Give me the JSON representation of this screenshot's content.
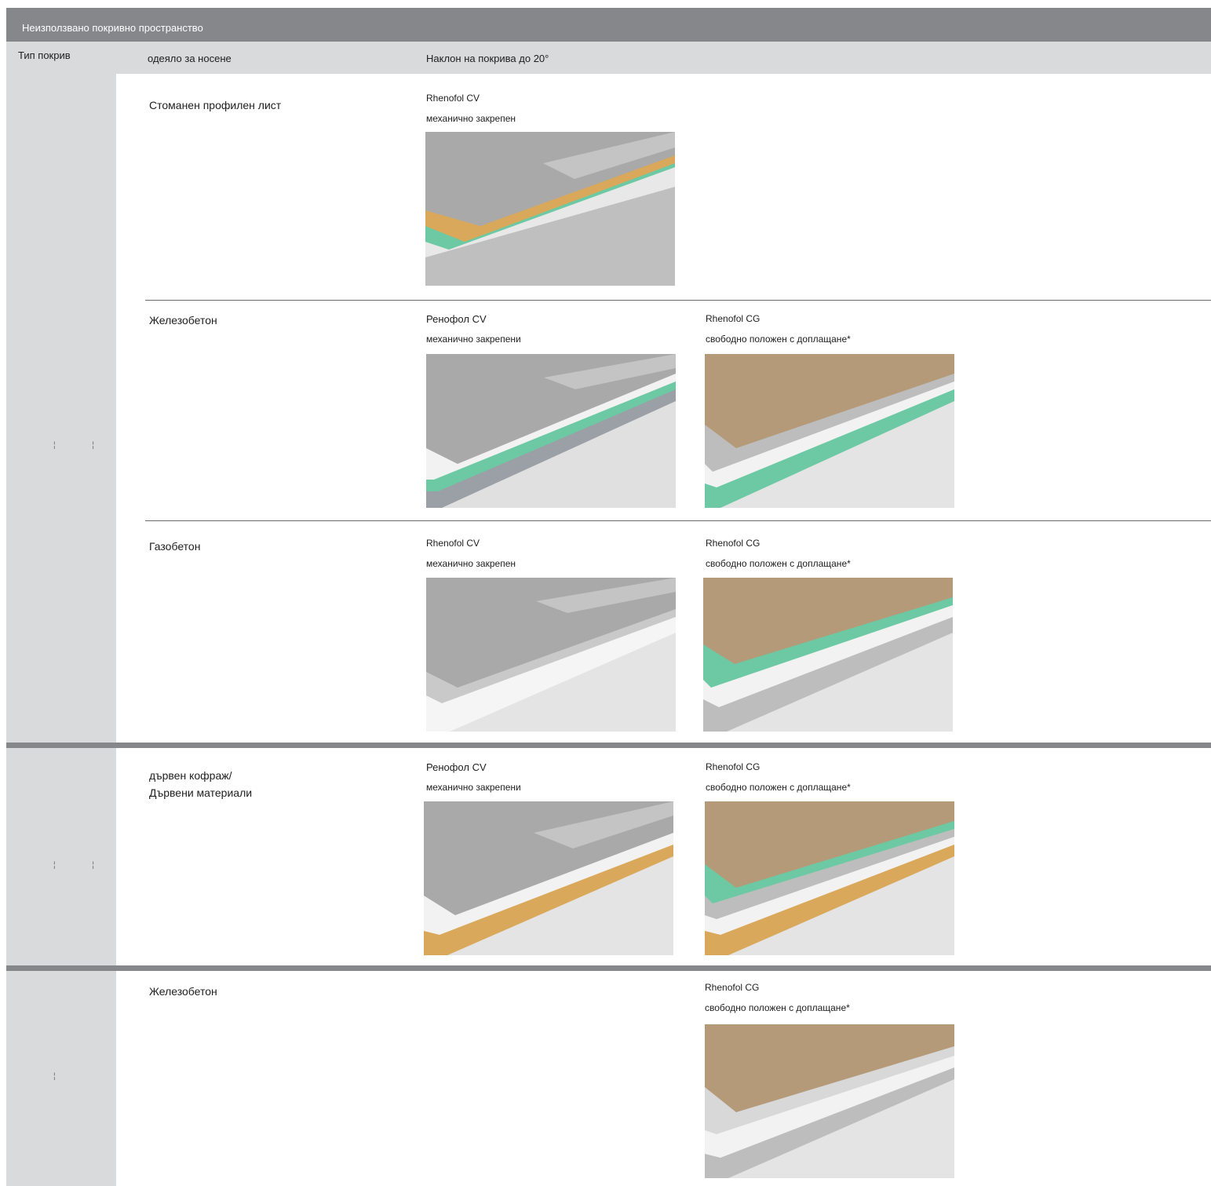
{
  "header": {
    "title": "Неизползвано покривно пространство"
  },
  "columns": {
    "roof_type": "Тип покрив",
    "deck": "одеяло за носене",
    "slope": "Наклон на покрива до 20°"
  },
  "rows": [
    {
      "label": "Стоманен профилен лист",
      "p1": {
        "name": "Rhenofol CV",
        "desc": "механично закрепен"
      }
    },
    {
      "label": "Железобетон",
      "p1": {
        "name": "Ренофол CV",
        "desc": "механично закрепени"
      },
      "p2": {
        "name": "Rhenofol CG",
        "desc": "свободно положен с доплащане*"
      }
    },
    {
      "label": "Газобетон",
      "p1": {
        "name": "Rhenofol CV",
        "desc": "механично закрепен"
      },
      "p2": {
        "name": "Rhenofol CG",
        "desc": "свободно положен с доплащане*"
      }
    },
    {
      "label": "дървен кофраж/",
      "label2": "Дървени материали",
      "p1": {
        "name": "Ренофол CV",
        "desc": "механично закрепени"
      },
      "p2": {
        "name": "Rhenofol CG",
        "desc": "свободно положен с доплащане*"
      }
    },
    {
      "label": "Железобетон",
      "p2": {
        "name": "Rhenofol CG",
        "desc": "свободно положен с доплащане*"
      }
    }
  ],
  "ticks": {
    "a": "¦ ¦",
    "b": "¦ ¦",
    "c": "¦"
  },
  "colors": {
    "header_bg": "#86878b",
    "subheader_bg": "#d9dadc",
    "insulation_green": "#6cc9a4",
    "wood": "#d9a85a",
    "gravel": "#b49a78",
    "membrane_grey": "#a9a9a9"
  }
}
